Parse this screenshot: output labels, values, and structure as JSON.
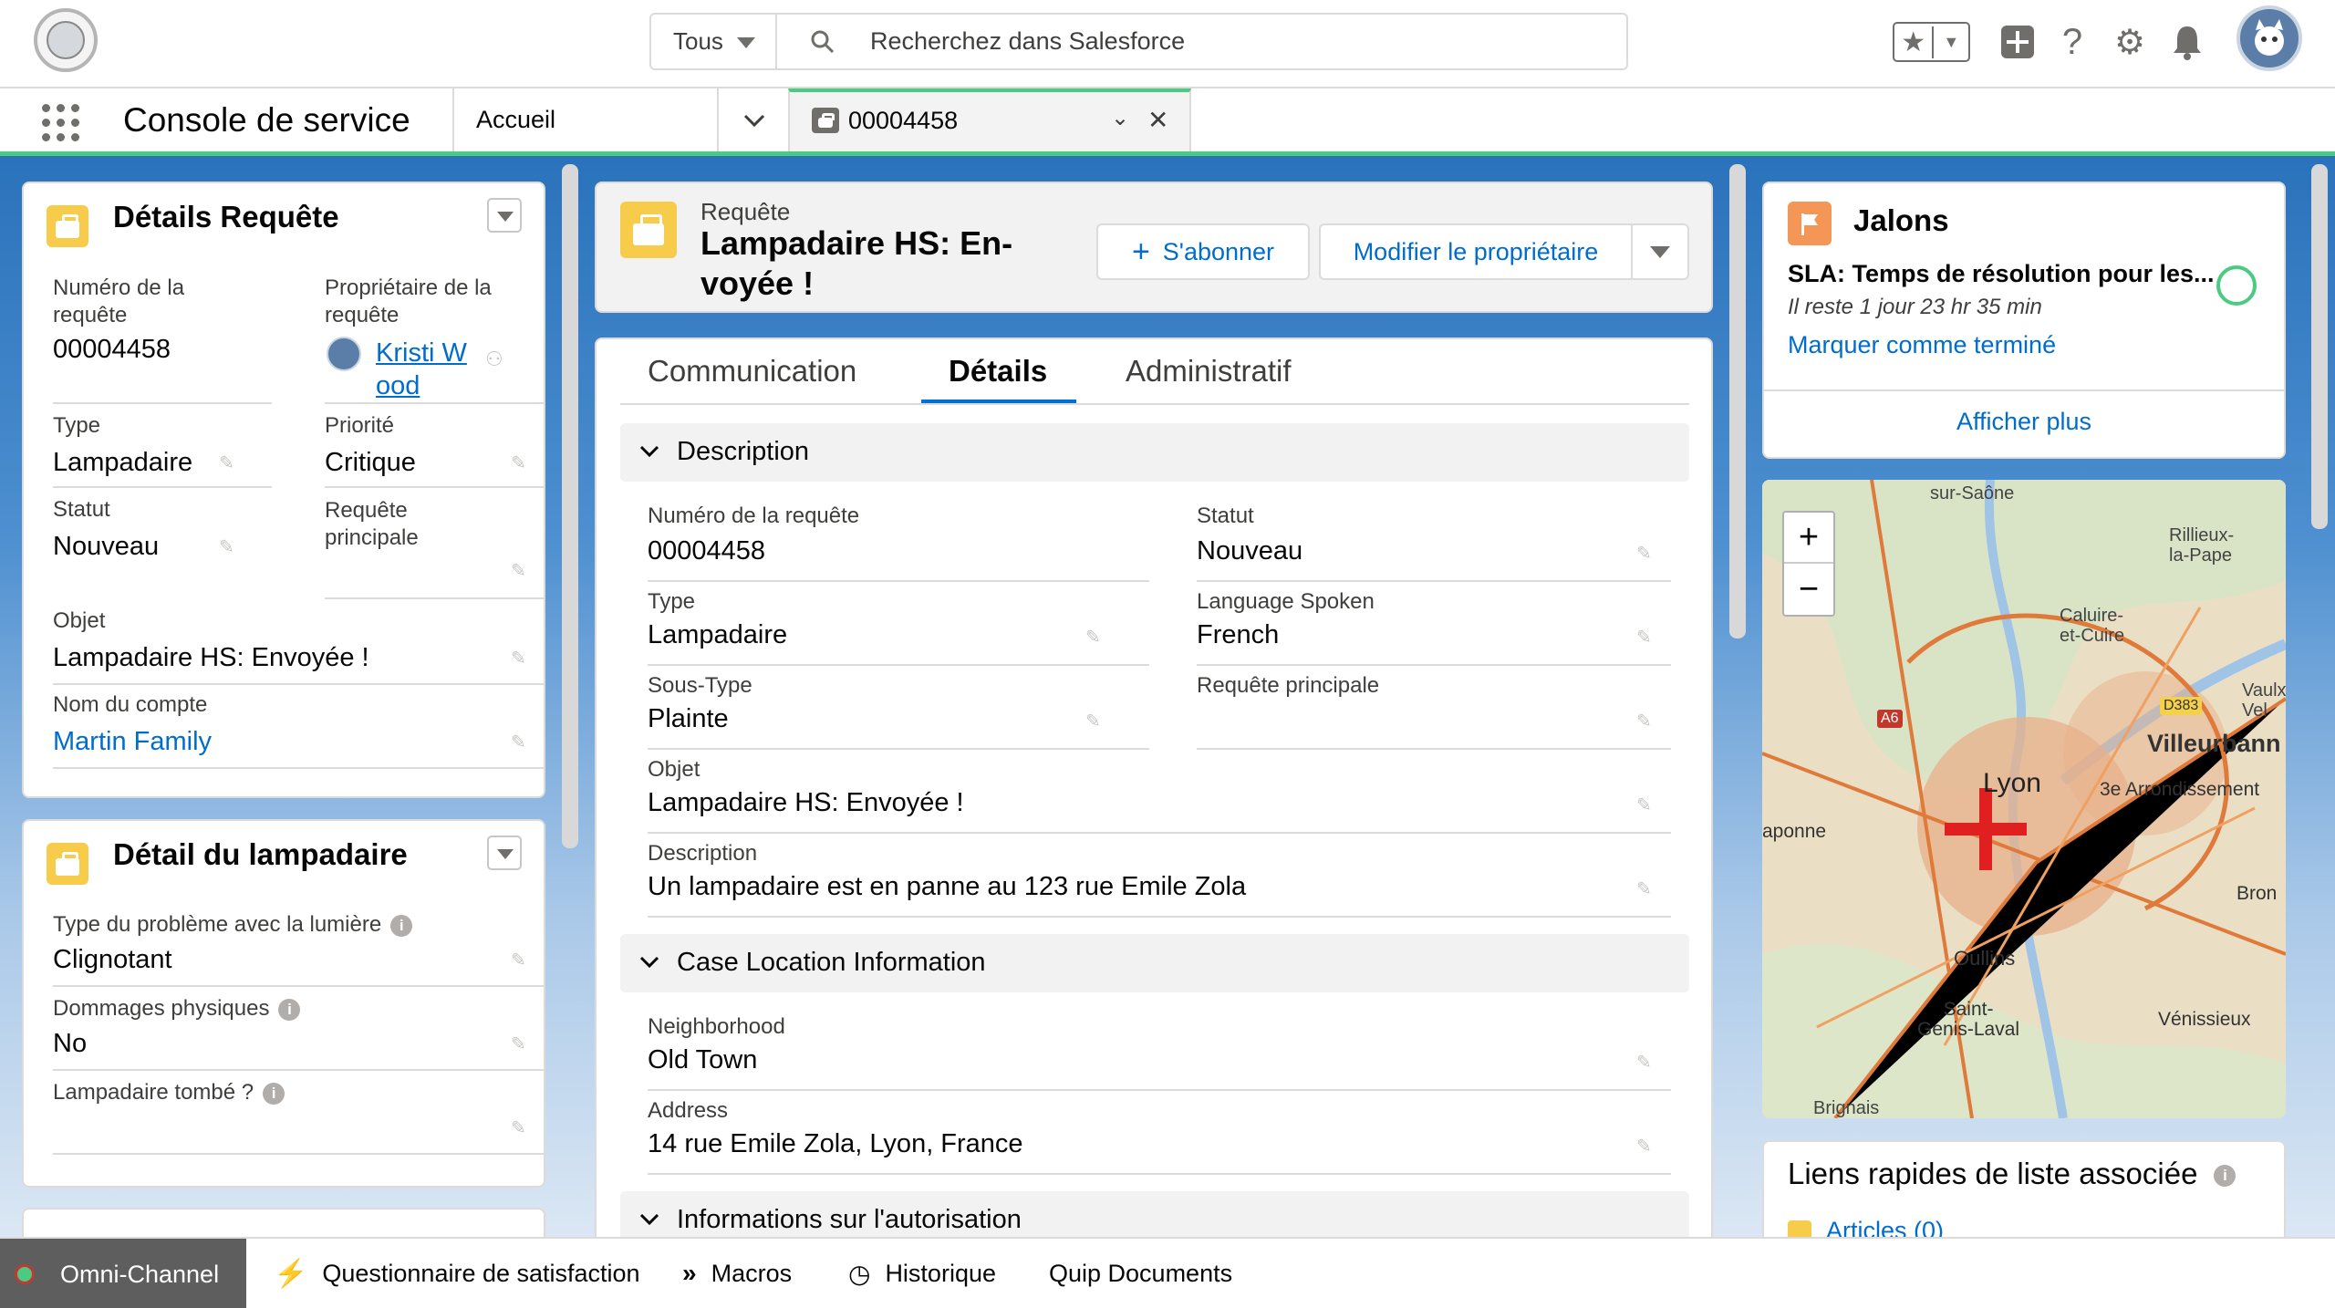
{
  "header": {
    "search_scope": "Tous",
    "search_placeholder": "Recherchez dans Salesforce"
  },
  "nav": {
    "app_name": "Console de service",
    "tabs": [
      {
        "label": "Accueil"
      },
      {
        "label": "00004458"
      }
    ]
  },
  "left_card1": {
    "title": "Détails Requête",
    "fields": {
      "case_number_label": "Numéro de la requête",
      "case_number": "00004458",
      "owner_label": "Propriétaire de la requête",
      "owner_line1": "Kristi W",
      "owner_line2": "ood",
      "type_label": "Type",
      "type": "Lampadaire",
      "priority_label": "Priorité",
      "priority": "Critique",
      "status_label": "Statut",
      "status": "Nouveau",
      "parent_label": "Requête principale",
      "subject_label": "Objet",
      "subject": "Lampadaire HS: Envoyée !",
      "account_label": "Nom du compte",
      "account": "Martin Family"
    }
  },
  "left_card2": {
    "title": "Détail du lampadaire",
    "fields": {
      "problem_label": "Type du problème avec la lumière",
      "problem": "Clignotant",
      "damage_label": "Dommages physiques",
      "damage": "No",
      "fallen_label": "Lampadaire tombé ?"
    }
  },
  "case_header": {
    "object_label": "Requête",
    "title_line1": "Lampadaire HS: En-",
    "title_line2": "voyée !",
    "subscribe_label": "S'abonner",
    "change_owner_label": "Modifier le propriétaire"
  },
  "detail_tabs": [
    {
      "label": "Communication"
    },
    {
      "label": "Détails"
    },
    {
      "label": "Administratif"
    }
  ],
  "sections": {
    "description": {
      "title": "Description",
      "case_number_label": "Numéro de la requête",
      "case_number": "00004458",
      "status_label": "Statut",
      "status": "Nouveau",
      "type_label": "Type",
      "type": "Lampadaire",
      "language_label": "Language Spoken",
      "language": "French",
      "subtype_label": "Sous-Type",
      "subtype": "Plainte",
      "parent_label": "Requête principale",
      "subject_label": "Objet",
      "subject": "Lampadaire HS: Envoyée !",
      "description_label": "Description",
      "description": "Un lampadaire est en panne au 123 rue Emile Zola"
    },
    "location": {
      "title": "Case Location Information",
      "neighborhood_label": "Neighborhood",
      "neighborhood": "Old Town",
      "address_label": "Address",
      "address": "14 rue Emile Zola, Lyon, France"
    },
    "authorization": {
      "title": "Informations sur l'autorisation"
    }
  },
  "milestones": {
    "title": "Jalons",
    "sla_name": "SLA: Temps de résolution pour les...",
    "remaining": "Il reste 1 jour 23 hr 35 min",
    "mark_complete": "Marquer comme terminé",
    "show_more": "Afficher plus"
  },
  "map": {
    "labels": {
      "top": "sur-Saône",
      "rillieux": "Rillieux-\nla-Pape",
      "caluire": "Caluire-\net-Cuire",
      "vaulx": "Vaulx-\nVel",
      "villeurbanne": "Villeurbann",
      "lyon": "Lyon",
      "arr3": "3e Arrondissement",
      "bron": "Bron",
      "oullins": "Oullins",
      "saint_genis": "Saint-\nGenis-Laval",
      "venissieux": "Vénissieux",
      "brignais": "Brignais",
      "aponne": "aponne",
      "a6": "A6",
      "d383": "D383"
    }
  },
  "quick_links": {
    "title": "Liens rapides de liste associée",
    "articles": "Articles (0)"
  },
  "footer": {
    "items": [
      {
        "label": "Omni-Channel"
      },
      {
        "label": "Questionnaire de satisfaction"
      },
      {
        "label": "Macros"
      },
      {
        "label": "Historique"
      },
      {
        "label": "Quip Documents"
      }
    ]
  },
  "colors": {
    "accent_green": "#4bca81",
    "link_blue": "#006dcc",
    "case_yellow": "#f8cc4b",
    "milestone_orange": "#f49756"
  }
}
